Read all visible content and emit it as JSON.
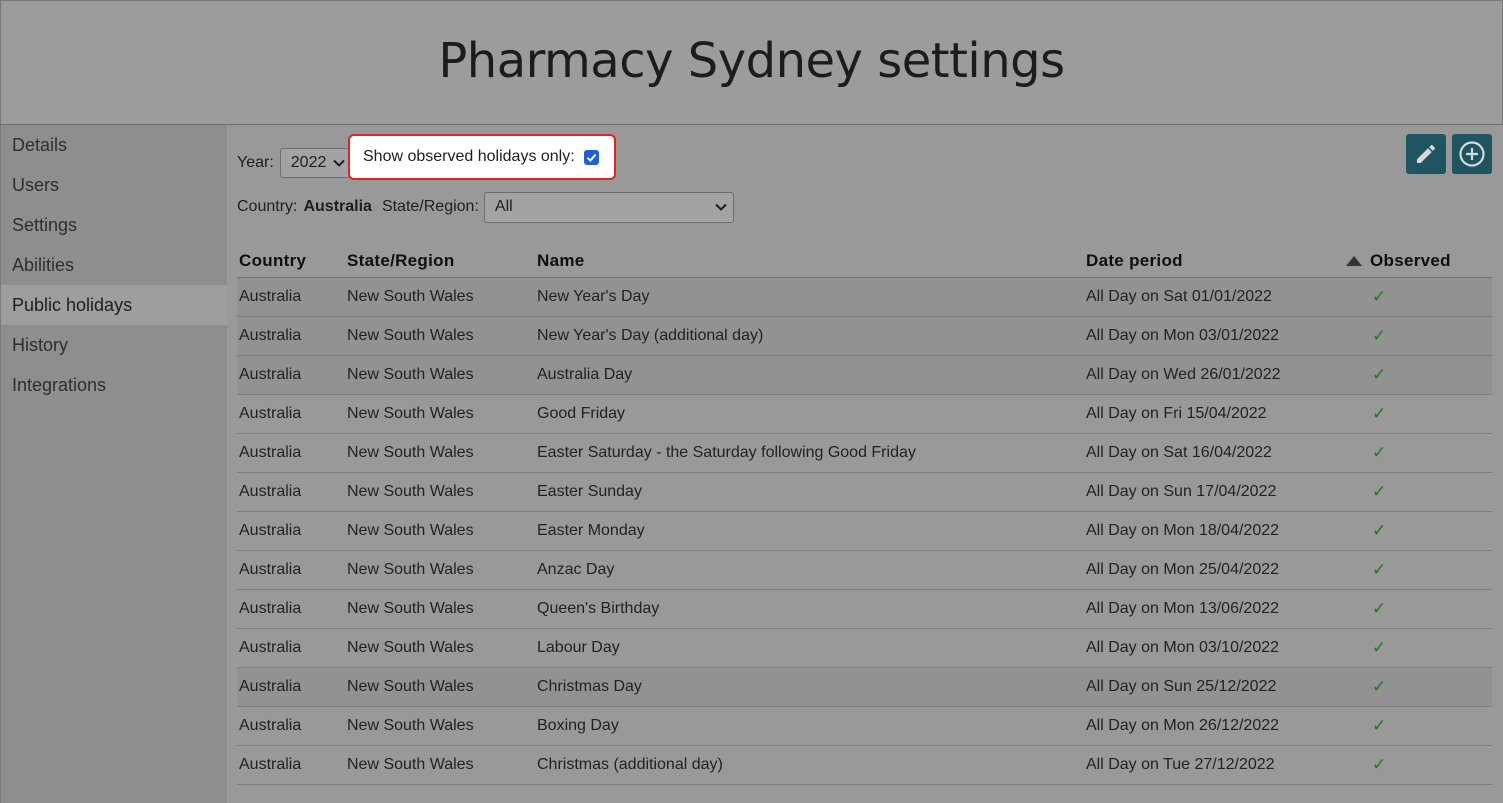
{
  "header": {
    "title": "Pharmacy Sydney settings"
  },
  "sidebar": {
    "items": [
      {
        "label": "Details"
      },
      {
        "label": "Users"
      },
      {
        "label": "Settings"
      },
      {
        "label": "Abilities"
      },
      {
        "label": "Public holidays",
        "active": true
      },
      {
        "label": "History"
      },
      {
        "label": "Integrations"
      }
    ]
  },
  "filters": {
    "year_label": "Year:",
    "year_value": "2022",
    "observed_label": "Show observed holidays only:",
    "observed_checked": true,
    "country_label": "Country:",
    "country_value": "Australia",
    "state_label": "State/Region:",
    "state_value": "All"
  },
  "toolbar": {
    "edit_icon": "pencil-icon",
    "add_icon": "plus-circle-icon",
    "accent": "#1e5560"
  },
  "table": {
    "headers": [
      "Country",
      "State/Region",
      "Name",
      "Date period",
      "Observed"
    ],
    "sort_icon": "sort-up-triangle-icon",
    "rows": [
      {
        "country": "Australia",
        "state": "New South Wales",
        "name": "New Year's Day",
        "date": "All Day on Sat 01/01/2022",
        "observed": "✓"
      },
      {
        "country": "Australia",
        "state": "New South Wales",
        "name": "New Year's Day (additional day)",
        "date": "All Day on Mon 03/01/2022",
        "observed": "✓"
      },
      {
        "country": "Australia",
        "state": "New South Wales",
        "name": "Australia Day",
        "date": "All Day on Wed 26/01/2022",
        "observed": "✓"
      },
      {
        "country": "Australia",
        "state": "New South Wales",
        "name": "Good Friday",
        "date": "All Day on Fri 15/04/2022",
        "observed": "✓"
      },
      {
        "country": "Australia",
        "state": "New South Wales",
        "name": "Easter Saturday - the Saturday following Good Friday",
        "date": "All Day on Sat 16/04/2022",
        "observed": "✓"
      },
      {
        "country": "Australia",
        "state": "New South Wales",
        "name": "Easter Sunday",
        "date": "All Day on Sun 17/04/2022",
        "observed": "✓"
      },
      {
        "country": "Australia",
        "state": "New South Wales",
        "name": "Easter Monday",
        "date": "All Day on Mon 18/04/2022",
        "observed": "✓"
      },
      {
        "country": "Australia",
        "state": "New South Wales",
        "name": "Anzac Day",
        "date": "All Day on Mon 25/04/2022",
        "observed": "✓"
      },
      {
        "country": "Australia",
        "state": "New South Wales",
        "name": "Queen's Birthday",
        "date": "All Day on Mon 13/06/2022",
        "observed": "✓"
      },
      {
        "country": "Australia",
        "state": "New South Wales",
        "name": "Labour Day",
        "date": "All Day on Mon 03/10/2022",
        "observed": "✓"
      },
      {
        "country": "Australia",
        "state": "New South Wales",
        "name": "Christmas Day",
        "date": "All Day on Sun 25/12/2022",
        "observed": "✓"
      },
      {
        "country": "Australia",
        "state": "New South Wales",
        "name": "Boxing Day",
        "date": "All Day on Mon 26/12/2022",
        "observed": "✓"
      },
      {
        "country": "Australia",
        "state": "New South Wales",
        "name": "Christmas (additional day)",
        "date": "All Day on Tue 27/12/2022",
        "observed": "✓"
      }
    ]
  }
}
